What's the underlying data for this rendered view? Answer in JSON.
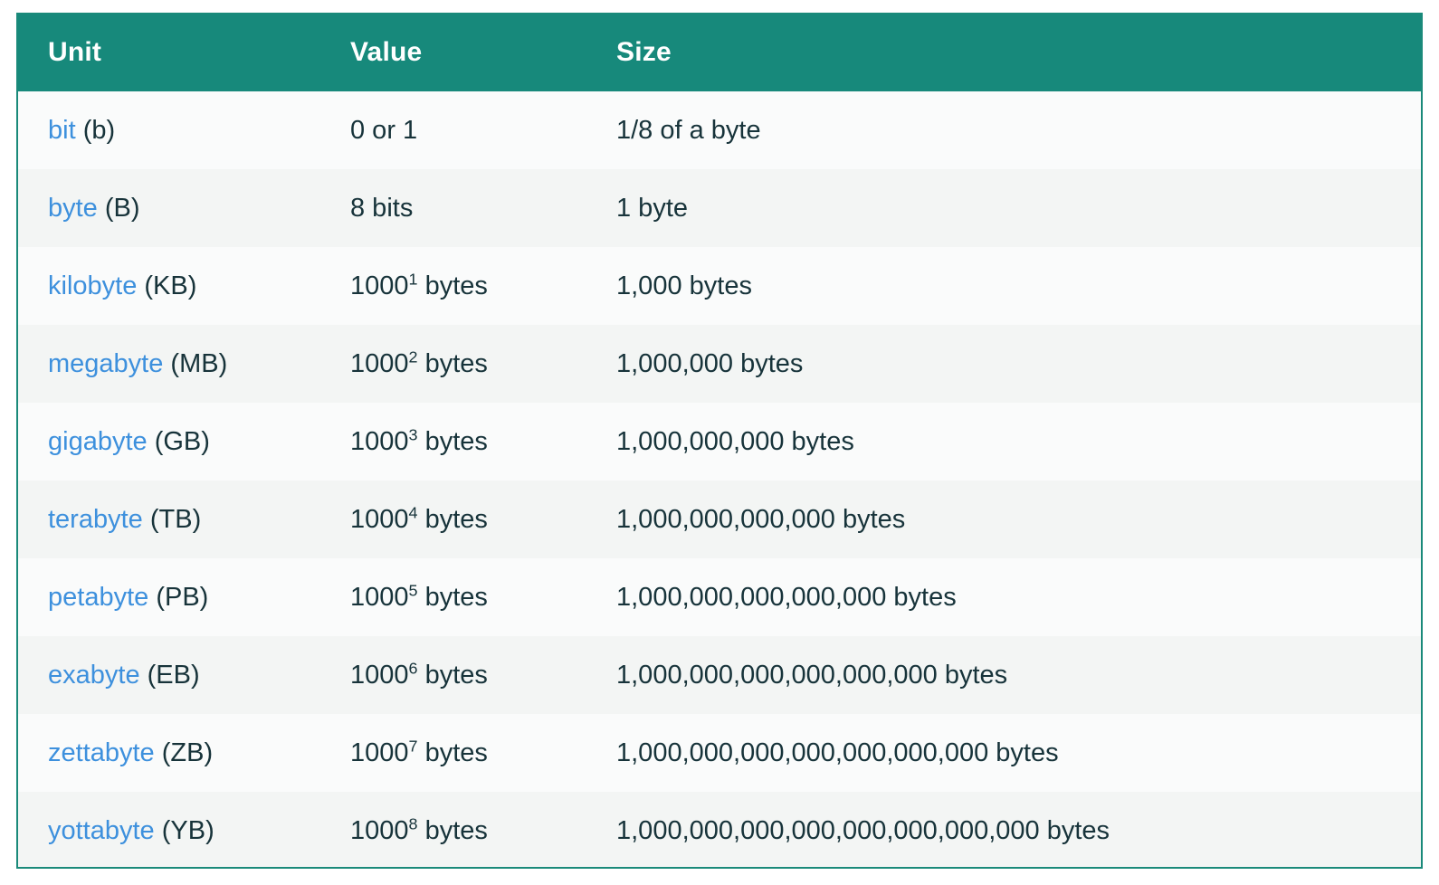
{
  "table": {
    "columns": [
      "Unit",
      "Value",
      "Size"
    ],
    "accent_color": "#17897b",
    "link_color": "#3d90dd",
    "text_color": "#17333a",
    "border_color": "#1a8a7a",
    "row_bg_odd": "#fafbfb",
    "row_bg_even": "#f3f5f4",
    "rows": [
      {
        "unit_name": "bit",
        "unit_abbr": "(b)",
        "value_base": "0 or 1",
        "value_exponent": "",
        "value_suffix": "",
        "size": "1/8 of a byte"
      },
      {
        "unit_name": "byte",
        "unit_abbr": "(B)",
        "value_base": "8 bits",
        "value_exponent": "",
        "value_suffix": "",
        "size": "1 byte"
      },
      {
        "unit_name": "kilobyte",
        "unit_abbr": "(KB)",
        "value_base": "1000",
        "value_exponent": "1",
        "value_suffix": " bytes",
        "size": "1,000 bytes"
      },
      {
        "unit_name": "megabyte",
        "unit_abbr": "(MB)",
        "value_base": "1000",
        "value_exponent": "2",
        "value_suffix": " bytes",
        "size": "1,000,000 bytes"
      },
      {
        "unit_name": "gigabyte",
        "unit_abbr": "(GB)",
        "value_base": "1000",
        "value_exponent": "3",
        "value_suffix": " bytes",
        "size": "1,000,000,000 bytes"
      },
      {
        "unit_name": "terabyte",
        "unit_abbr": "(TB)",
        "value_base": "1000",
        "value_exponent": "4",
        "value_suffix": " bytes",
        "size": "1,000,000,000,000 bytes"
      },
      {
        "unit_name": "petabyte",
        "unit_abbr": "(PB)",
        "value_base": "1000",
        "value_exponent": "5",
        "value_suffix": " bytes",
        "size": "1,000,000,000,000,000 bytes"
      },
      {
        "unit_name": "exabyte",
        "unit_abbr": "(EB)",
        "value_base": "1000",
        "value_exponent": "6",
        "value_suffix": " bytes",
        "size": "1,000,000,000,000,000,000 bytes"
      },
      {
        "unit_name": "zettabyte",
        "unit_abbr": "(ZB)",
        "value_base": "1000",
        "value_exponent": "7",
        "value_suffix": " bytes",
        "size": "1,000,000,000,000,000,000,000 bytes"
      },
      {
        "unit_name": "yottabyte",
        "unit_abbr": "(YB)",
        "value_base": "1000",
        "value_exponent": "8",
        "value_suffix": " bytes",
        "size": "1,000,000,000,000,000,000,000,000 bytes"
      }
    ]
  }
}
